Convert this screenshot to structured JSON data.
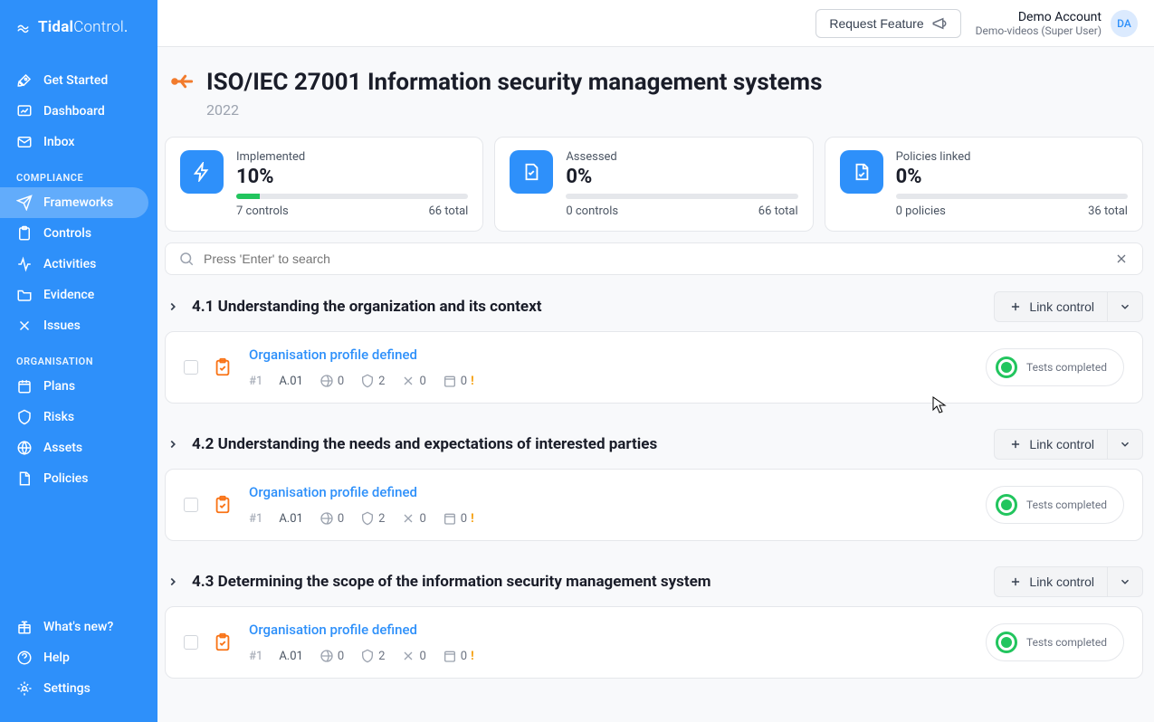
{
  "brand": {
    "bold": "Tidal",
    "light": "Control"
  },
  "nav": {
    "top": [
      {
        "label": "Get Started"
      },
      {
        "label": "Dashboard"
      },
      {
        "label": "Inbox"
      }
    ],
    "compliance_label": "COMPLIANCE",
    "compliance": [
      {
        "label": "Frameworks"
      },
      {
        "label": "Controls"
      },
      {
        "label": "Activities"
      },
      {
        "label": "Evidence"
      },
      {
        "label": "Issues"
      }
    ],
    "organisation_label": "ORGANISATION",
    "organisation": [
      {
        "label": "Plans"
      },
      {
        "label": "Risks"
      },
      {
        "label": "Assets"
      },
      {
        "label": "Policies"
      }
    ],
    "footer": [
      {
        "label": "What's new?"
      },
      {
        "label": "Help"
      },
      {
        "label": "Settings"
      }
    ]
  },
  "topbar": {
    "request_feature": "Request Feature",
    "account_name": "Demo Account",
    "account_role": "Demo-videos (Super User)",
    "avatar": "DA"
  },
  "page": {
    "title": "ISO/IEC 27001 Information security management systems",
    "year": "2022"
  },
  "stats": {
    "implemented": {
      "label": "Implemented",
      "value": "10%",
      "left": "7 controls",
      "right": "66 total",
      "pct": 10
    },
    "assessed": {
      "label": "Assessed",
      "value": "0%",
      "left": "0 controls",
      "right": "66 total",
      "pct": 0
    },
    "policies": {
      "label": "Policies linked",
      "value": "0%",
      "left": "0 policies",
      "right": "36 total",
      "pct": 0
    }
  },
  "search": {
    "placeholder": "Press 'Enter' to search"
  },
  "link_control_label": "Link control",
  "tests_completed_label": "Tests\ncompleted",
  "sections": [
    {
      "title": "4.1 Understanding the organization and its context",
      "item": {
        "name": "Organisation profile defined",
        "id": "#1",
        "ref": "A.01",
        "globe": "0",
        "shield": "2",
        "tool": "0",
        "cal": "0"
      }
    },
    {
      "title": "4.2 Understanding the needs and expectations of interested parties",
      "item": {
        "name": "Organisation profile defined",
        "id": "#1",
        "ref": "A.01",
        "globe": "0",
        "shield": "2",
        "tool": "0",
        "cal": "0"
      }
    },
    {
      "title": "4.3 Determining the scope of the information security management system",
      "item": {
        "name": "Organisation profile defined",
        "id": "#1",
        "ref": "A.01",
        "globe": "0",
        "shield": "2",
        "tool": "0",
        "cal": "0"
      }
    }
  ]
}
